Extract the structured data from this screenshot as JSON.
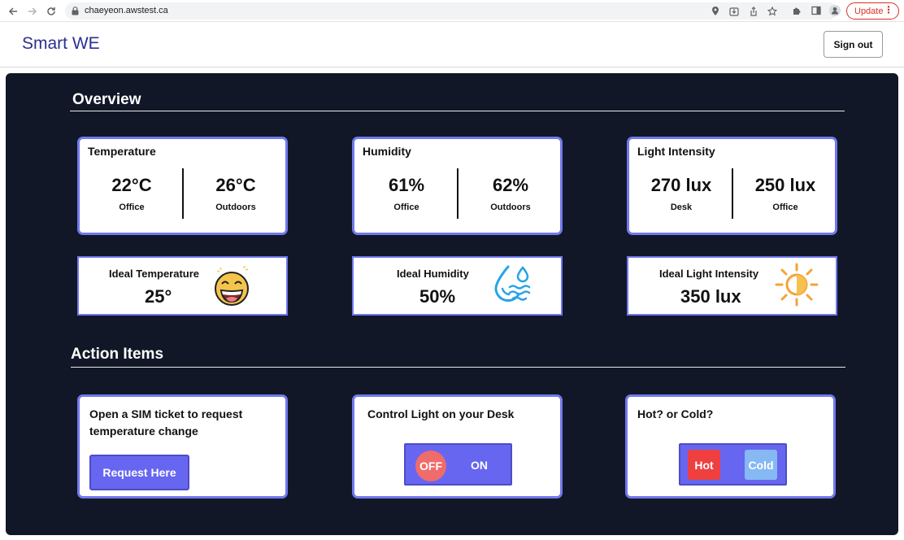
{
  "browser": {
    "url": "chaeyeon.awstest.ca",
    "update_label": "Update",
    "menu_glyph": "⋮"
  },
  "header": {
    "brand": "Smart WE",
    "signout_label": "Sign out"
  },
  "overview": {
    "title": "Overview",
    "cards": [
      {
        "title": "Temperature",
        "left_value": "22°C",
        "left_label": "Office",
        "right_value": "26°C",
        "right_label": "Outdoors"
      },
      {
        "title": "Humidity",
        "left_value": "61%",
        "left_label": "Office",
        "right_value": "62%",
        "right_label": "Outdoors"
      },
      {
        "title": "Light Intensity",
        "left_value": "270 lux",
        "left_label": "Desk",
        "right_value": "250 lux",
        "right_label": "Office"
      }
    ],
    "ideals": [
      {
        "title": "Ideal Temperature",
        "value": "25°",
        "icon": "laughing-face-icon"
      },
      {
        "title": "Ideal Humidity",
        "value": "50%",
        "icon": "water-drop-icon"
      },
      {
        "title": "Ideal Light Intensity",
        "value": "350 lux",
        "icon": "sun-icon"
      }
    ]
  },
  "actions": {
    "title": "Action Items",
    "ticket": {
      "title": "Open a SIM ticket to request temperature change",
      "button": "Request Here"
    },
    "light": {
      "title": "Control Light on your Desk",
      "off_label": "OFF",
      "on_label": "ON"
    },
    "climate": {
      "title": "Hot? or Cold?",
      "hot_label": "Hot",
      "cold_label": "Cold"
    }
  },
  "colors": {
    "panel_bg": "#121727",
    "card_border": "#7179ee",
    "brand": "#2b2f8f",
    "button": "#6766f0",
    "off": "#f06b6b",
    "hot": "#ef3f3f",
    "cold": "#86b8f4"
  }
}
